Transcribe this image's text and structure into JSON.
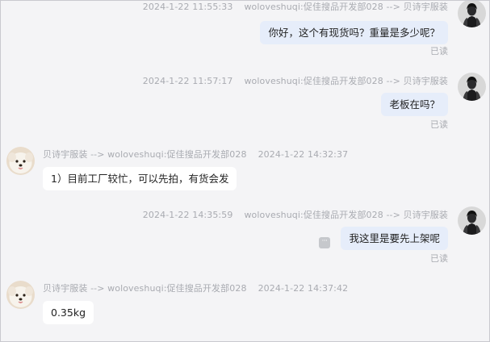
{
  "messages": [
    {
      "direction": "outgoing",
      "time": "2024-1-22 11:55:33",
      "route": "woloveshuqi:促佳搜品开发部028 --> 贝诗宇服装",
      "text": "你好，这个有现货吗？重量是多少呢？",
      "status": "已读"
    },
    {
      "direction": "outgoing",
      "time": "2024-1-22 11:57:17",
      "route": "woloveshuqi:促佳搜品开发部028 --> 贝诗宇服装",
      "text": "老板在吗？",
      "status": "已读"
    },
    {
      "direction": "incoming",
      "time": "2024-1-22 14:32:37",
      "route": "贝诗宇服装 --> woloveshuqi:促佳搜品开发部028",
      "text": "1）目前工厂较忙，可以先拍，有货会发"
    },
    {
      "direction": "outgoing",
      "time": "2024-1-22 14:35:59",
      "route": "woloveshuqi:促佳搜品开发部028 --> 贝诗宇服装",
      "text": "我这里是要先上架呢",
      "status": "已读"
    },
    {
      "direction": "incoming",
      "time": "2024-1-22 14:37:42",
      "route": "贝诗宇服装 --> woloveshuqi:促佳搜品开发部028",
      "text": "0.35kg"
    }
  ],
  "more_button_glyph": "···",
  "colors": {
    "background": "#f4f4f6",
    "outgoing_bubble": "#e6edfa",
    "incoming_bubble": "#ffffff",
    "meta_text": "#a9abb1"
  },
  "icons": {
    "self_avatar": "dark-figure-avatar",
    "peer_avatar": "fluffy-dog-avatar",
    "more": "more-options-icon"
  }
}
